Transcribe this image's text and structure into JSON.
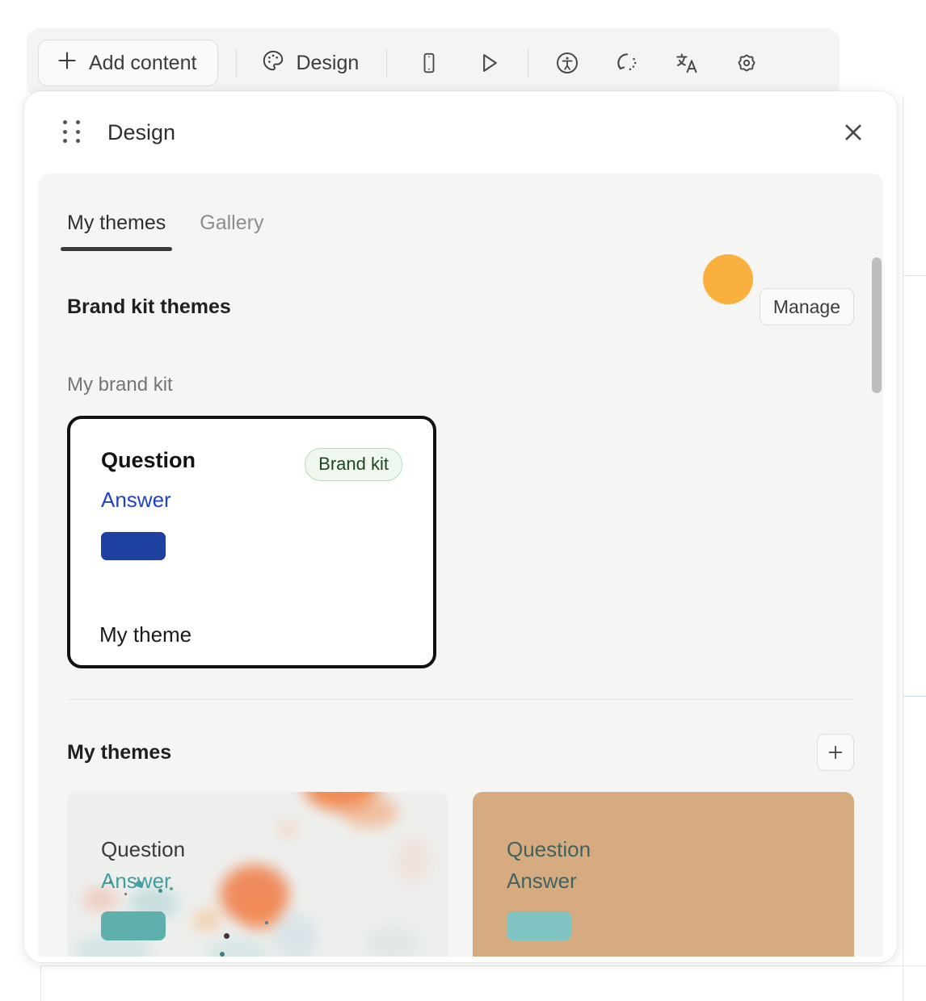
{
  "toolbar": {
    "add_content_label": "Add content",
    "design_label": "Design",
    "icons": [
      {
        "name": "mobile-preview-icon",
        "title": "Mobile preview"
      },
      {
        "name": "play-icon",
        "title": "Present"
      },
      {
        "name": "accessibility-icon",
        "title": "Accessibility"
      },
      {
        "name": "version-history-icon",
        "title": "Version history"
      },
      {
        "name": "translate-icon",
        "title": "Translate"
      },
      {
        "name": "settings-gear-icon",
        "title": "Settings"
      }
    ]
  },
  "panel": {
    "title": "Design",
    "close_label": "✕",
    "tabs": [
      {
        "label": "My themes",
        "active": true
      },
      {
        "label": "Gallery",
        "active": false
      }
    ],
    "brand_kit_section": {
      "title": "Brand kit themes",
      "manage_label": "Manage",
      "subsection_label": "My brand kit",
      "card": {
        "question": "Question",
        "answer": "Answer",
        "badge": "Brand kit",
        "name": "My theme",
        "swatch_color": "#1e40a0",
        "answer_color": "#2243c7",
        "background_color": "#ffffff",
        "border_color": "#111111",
        "badge_bg": "#eff7ef",
        "badge_border": "#b6dcbe",
        "badge_text_color": "#1d4722"
      }
    },
    "my_themes_section": {
      "title": "My themes",
      "add_label": "+",
      "cards": [
        {
          "question": "Question",
          "answer": "Answer",
          "style": "watercolor",
          "background_color": "#eef0ee",
          "question_color": "#3a3a3a",
          "answer_color": "#3f9e9c",
          "swatch_color": "#5fb0ac"
        },
        {
          "question": "Question",
          "answer": "Answer",
          "style": "solid",
          "background_color": "#d6ab80",
          "question_color": "#406361",
          "answer_color": "#406361",
          "swatch_color": "#7fc4c2"
        }
      ]
    }
  },
  "cursor": {
    "highlight_color": "#f9b03f"
  }
}
